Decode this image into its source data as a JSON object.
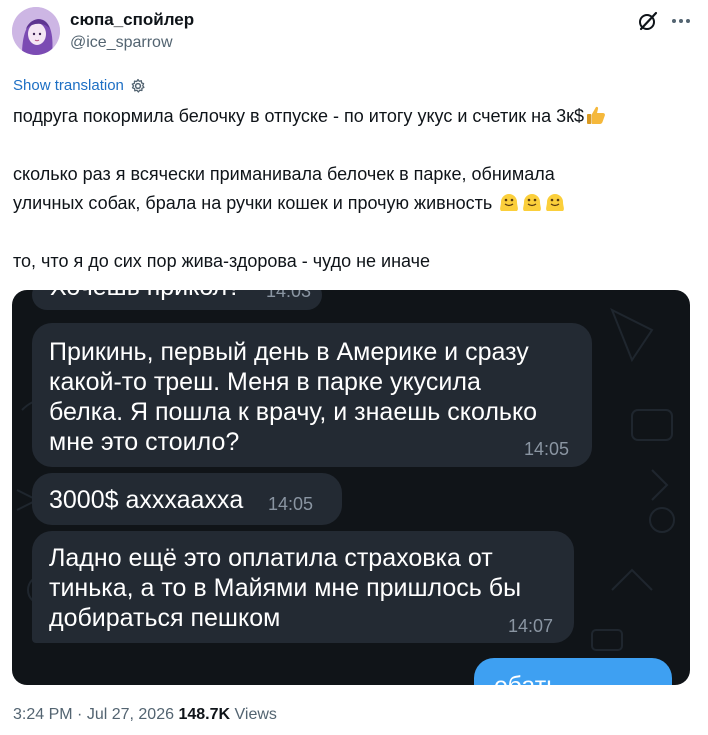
{
  "author": {
    "display_name": "сюпа_спойлер",
    "handle": "@ice_sparrow"
  },
  "actions": {
    "show_translation": "Show translation"
  },
  "tweet": {
    "line1": "подруга покормила белочку в отпуске - по итогу укус и счетик на 3к$",
    "para2_line1": "сколько раз я всячески приманивала белочек в парке, обнимала",
    "para2_line2": "уличных собак, брала на ручки кошек и прочую живность",
    "para3": "то, что я до сих пор жива-здорова - чудо не иначе"
  },
  "chat": {
    "messages": [
      {
        "text": "Хочешь прикол?",
        "time": "14:03"
      },
      {
        "text": "Прикинь, первый день в Америке и сразу\nкакой-то треш. Меня в парке укусила\nбелка. Я пошла к врачу, и знаешь сколько\nмне это стоило?",
        "time": "14:05"
      },
      {
        "text": "3000$ ахххааххa",
        "time": "14:05"
      },
      {
        "text": "Ладно ещё это оплатила страховка от\nтинька, а то в Майями мне пришлось бы\nдобираться пешком",
        "time": "14:07"
      }
    ],
    "outgoing_partial": "ебать"
  },
  "meta": {
    "time": "3:24 PM",
    "separator": " · ",
    "date": "Jul 27, 2026",
    "views_count": "148.7K",
    "views_label": "Views"
  },
  "colors": {
    "link": "#1d6fc4",
    "incoming_bubble": "#232a33",
    "outgoing_bubble": "#3ea0f2",
    "chat_background": "#101418"
  },
  "icons": [
    "grok-icon",
    "more-icon",
    "gear-icon",
    "thumbs-up-emoji",
    "melting-face-emoji"
  ]
}
